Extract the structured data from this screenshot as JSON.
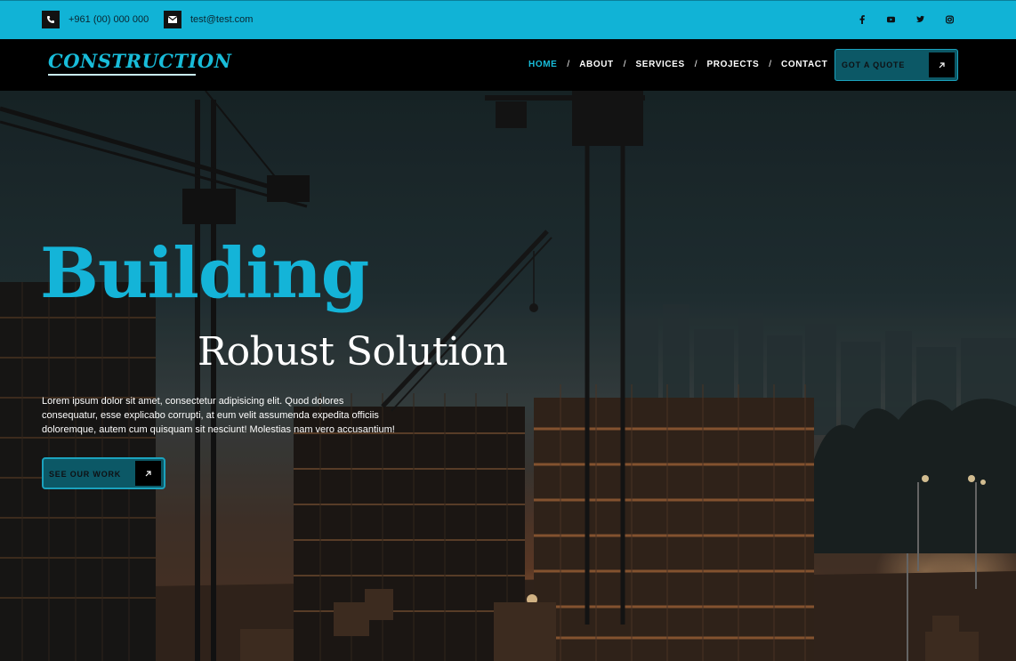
{
  "topbar": {
    "phone": {
      "icon": "phone-icon",
      "text": "+961 (00) 000 000"
    },
    "email": {
      "icon": "mail-icon",
      "text": "test@test.com"
    },
    "socials": [
      "facebook-icon",
      "youtube-icon",
      "twitter-icon",
      "instagram-icon"
    ],
    "bg_color": "#11b3d6"
  },
  "nav": {
    "logo": "CONSTRUCTION",
    "items": [
      {
        "label": "HOME",
        "active": true
      },
      {
        "label": "ABOUT",
        "active": false
      },
      {
        "label": "SERVICES",
        "active": false
      },
      {
        "label": "PROJECTS",
        "active": false
      },
      {
        "label": "CONTACT",
        "active": false
      }
    ],
    "separator": "/",
    "cta": {
      "label": "GOT A QUOTE",
      "icon": "arrow-up-right-icon"
    }
  },
  "hero": {
    "title_1": "Building",
    "title_2": "Robust Solution",
    "text": "Lorem ipsum dolor sit amet, consectetur adipisicing elit. Quod dolores consequatur, esse explicabo corrupti, at eum velit assumenda expedita officiis doloremque, autem cum quisquam sit nesciunt! Molestias nam vero accusantium!",
    "cta": {
      "label": "SEE OUR WORK",
      "icon": "arrow-up-right-icon"
    },
    "accent_color": "#14b4d8"
  }
}
